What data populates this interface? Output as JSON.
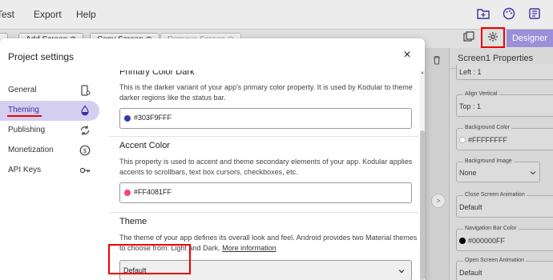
{
  "menubar": {
    "items": [
      "Test",
      "Export",
      "Help"
    ],
    "icons": [
      "folder-icon",
      "palette-icon",
      "library-icon"
    ]
  },
  "toolbar": {
    "add_screen": "Add Screen ⊕",
    "copy_screen": "Copy Screen ⊕",
    "remove_screen": "Remove Screen ⊖",
    "designer": "Designer"
  },
  "properties": {
    "title": "Screen1 Properties",
    "left_value": "Left : 1",
    "align_vertical_label": "Align Vertical",
    "align_vertical_value": "Top : 1",
    "background_color_label": "Background Color",
    "background_color_value": "#FFFFFFFF",
    "background_image_label": "Background Image",
    "background_image_value": "None",
    "close_anim_label": "Close Screen Animation",
    "close_anim_value": "Default",
    "navbar_color_label": "Navigation Bar Color",
    "navbar_color_value": "#000000FF",
    "open_anim_label": "Open Screen Animation",
    "open_anim_value": "Default"
  },
  "modal": {
    "title": "Project settings",
    "close": "×",
    "nav": [
      {
        "label": "General",
        "icon": "phone-settings-icon"
      },
      {
        "label": "Theming",
        "icon": "water-drop-icon"
      },
      {
        "label": "Publishing",
        "icon": "sync-icon"
      },
      {
        "label": "Monetization",
        "icon": "dollar-icon"
      },
      {
        "label": "API Keys",
        "icon": "key-icon"
      }
    ],
    "active_nav": "Theming"
  },
  "theming": {
    "primary_dark": {
      "title": "Primary Color Dark",
      "desc": "This is the darker variant of your app's primary color property. It is used by Kodular to theme darker regions like the status bar.",
      "value": "#303F9FFF",
      "swatch": "#303F9F"
    },
    "accent": {
      "title": "Accent Color",
      "desc": "This property is used to accent and theme secondary elements of your app. Kodular applies accents to scrollbars, text box cursors, checkboxes, etc.",
      "value": "#FF4081FF",
      "swatch": "#FF4081"
    },
    "theme": {
      "title": "Theme",
      "desc": "The theme of your app defines its overall look and feel. Android provides two Material themes to choose from: Light and Dark.",
      "more_info": "More information",
      "selected": "Default"
    }
  },
  "colors": {
    "accent_purple": "#9b8fd8",
    "active_nav_bg": "#d4cff0",
    "highlight_red": "#ee0000"
  }
}
